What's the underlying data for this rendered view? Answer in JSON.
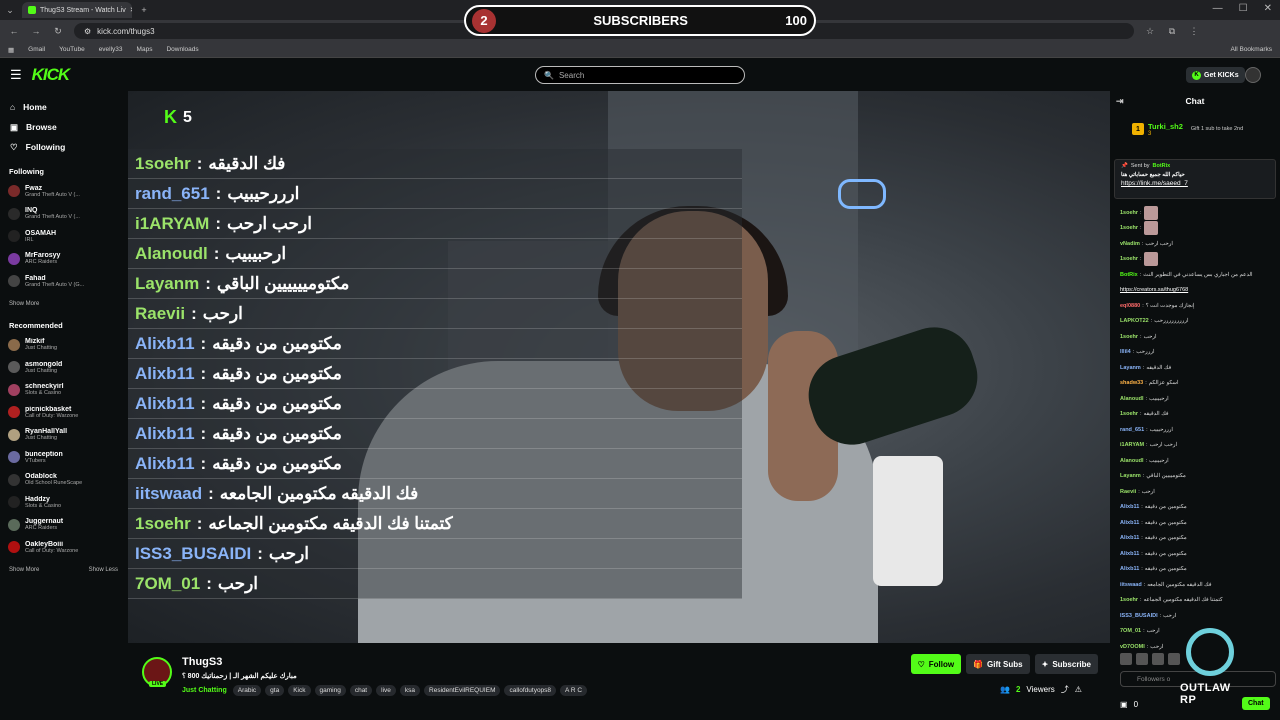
{
  "browser": {
    "tab_title": "ThugS3 Stream - Watch Liv",
    "url": "kick.com/thugs3",
    "bookmarks": [
      "Gmail",
      "YouTube",
      "evelly33",
      "Maps",
      "Downloads"
    ],
    "all_bookmarks": "All Bookmarks"
  },
  "sub_goal": {
    "current": "2",
    "label": "SUBSCRIBERS",
    "target": "100",
    "progress": 0.02
  },
  "header": {
    "logo": "KICK",
    "search_placeholder": "Search",
    "get_kicks": "Get KICKs"
  },
  "sidebar": {
    "nav": [
      {
        "label": "Home"
      },
      {
        "label": "Browse"
      },
      {
        "label": "Following"
      }
    ],
    "following_title": "Following",
    "following": [
      {
        "name": "Fwaz",
        "game": "Grand Theft Auto V (...",
        "viewers": "9.9K",
        "color": "#7a2a2a"
      },
      {
        "name": "INQ",
        "game": "Grand Theft Auto V (...",
        "viewers": "8.3K",
        "color": "#2a2a2a"
      },
      {
        "name": "OSAMAH",
        "game": "IRL",
        "viewers": "4.8K",
        "color": "#222"
      },
      {
        "name": "MrFarosyy",
        "game": "ARC Raiders",
        "viewers": "820",
        "color": "#7a3aa0"
      },
      {
        "name": "Fahad",
        "game": "Grand Theft Auto V (G...",
        "viewers": "791",
        "color": "#444"
      }
    ],
    "show_more": "Show More",
    "recommended_title": "Recommended",
    "recommended": [
      {
        "name": "Mizkif",
        "game": "Just Chatting",
        "viewers": "6.6K",
        "color": "#8a6a4a"
      },
      {
        "name": "asmongold",
        "game": "Just Chatting",
        "viewers": "10.8K",
        "color": "#5a5a5a"
      },
      {
        "name": "schneckyirl",
        "game": "Slots & Casino",
        "viewers": "1.8K",
        "color": "#a04060"
      },
      {
        "name": "picnickbasket",
        "game": "Call of Duty: Warzone",
        "viewers": "395",
        "color": "#b02020"
      },
      {
        "name": "RyanHallYall",
        "game": "Just Chatting",
        "viewers": "80",
        "color": "#b0a080"
      },
      {
        "name": "bunception",
        "game": "VTubers",
        "viewers": "55",
        "color": "#6a6aa0"
      },
      {
        "name": "Odablock",
        "game": "Old School RuneScape",
        "viewers": "9.2K",
        "color": "#333"
      },
      {
        "name": "Haddzy",
        "game": "Slots & Casino",
        "viewers": "1.8K",
        "color": "#222"
      },
      {
        "name": "Juggernaut",
        "game": "ARC Raiders",
        "viewers": "218",
        "color": "#5a6a5a"
      },
      {
        "name": "OakleyBoiii",
        "game": "Call of Duty: Warzone",
        "viewers": "152",
        "color": "#b01010"
      }
    ],
    "show_more_2": "Show More",
    "show_less": "Show Less"
  },
  "video": {
    "k_counter": "5",
    "overlay_chat": [
      {
        "user": "1soehr",
        "msg": "فك الدقيقه",
        "color": "#9be36a"
      },
      {
        "user": "rand_651",
        "msg": "ارررحيبيب",
        "color": "#8ab4f8"
      },
      {
        "user": "i1ARYAM",
        "msg": "ارحب ارحب",
        "color": "#9be36a"
      },
      {
        "user": "Alanoudl",
        "msg": "ارحبيبيب",
        "color": "#9be36a"
      },
      {
        "user": "Layanm",
        "msg": "مكتوميييييين الباقي",
        "color": "#9be36a"
      },
      {
        "user": "Raevii",
        "msg": "ارحب",
        "color": "#9be36a"
      },
      {
        "user": "Alixb11",
        "msg": "مكتومين من دقيقه",
        "color": "#8ab4f8"
      },
      {
        "user": "Alixb11",
        "msg": "مكتومين من دقيقه",
        "color": "#8ab4f8"
      },
      {
        "user": "Alixb11",
        "msg": "مكتومين من دقيقه",
        "color": "#8ab4f8"
      },
      {
        "user": "Alixb11",
        "msg": "مكتومين من دقيقه",
        "color": "#8ab4f8"
      },
      {
        "user": "Alixb11",
        "msg": "مكتومين من دقيقه",
        "color": "#8ab4f8"
      },
      {
        "user": "iitswaad",
        "msg": "فك الدقيقه مكتومين الجامعه",
        "color": "#8ab4f8"
      },
      {
        "user": "1soehr",
        "msg": "كتمتنا فك الدقيقه مكتومين الجماعه",
        "color": "#9be36a"
      },
      {
        "user": "ISS3_BUSAIDI",
        "msg": "ارحب",
        "color": "#8ab4f8"
      },
      {
        "user": "7OM_01",
        "msg": "ارحب",
        "color": "#9be36a"
      }
    ]
  },
  "chat": {
    "title": "Chat",
    "gift_user": "Turki_sh2",
    "gift_count": "3",
    "gift_text": "Gift 1 sub to take 2nd",
    "pinned": {
      "sent_by_label": "Sent by",
      "bot": "BotRix",
      "message": "حياكم الله جميع حساباتي هنا",
      "link": "https://link.me/saeed_7"
    },
    "messages": [
      {
        "user": "1soehr",
        "text": "",
        "color": "#9be36a",
        "emote": true
      },
      {
        "user": "1soehr",
        "text": "",
        "color": "#9be36a",
        "emote": true
      },
      {
        "user": "vNadim",
        "text": "ارحب ارحب",
        "color": "#9be36a"
      },
      {
        "user": "1soehr",
        "text": "",
        "color": "#9be36a",
        "emote": true
      },
      {
        "user": "BotRix",
        "text": "الدعم من اجباري بس يساعدني في التطوير النث",
        "color": "#53fc18"
      },
      {
        "user": "",
        "text": "https://creators.sa/thug6768",
        "color": "#fff"
      },
      {
        "user": "eql0880",
        "text": "إنجازك موجدت انت ؟",
        "color": "#ff6b6b"
      },
      {
        "user": "LAPKOT22",
        "text": "ارررررررررحب",
        "color": "#9be36a"
      },
      {
        "user": "1soehr",
        "text": "ارحب",
        "color": "#9be36a"
      },
      {
        "user": "lllil4",
        "text": "ارررحب",
        "color": "#8ab4f8"
      },
      {
        "user": "Layanm",
        "text": "فك الدقيقه",
        "color": "#8ab4f8"
      },
      {
        "user": "shadw33",
        "text": "اسكو عزالكم",
        "color": "#ffb347"
      },
      {
        "user": "Alanoudl",
        "text": "ارحبيبيب",
        "color": "#9be36a"
      },
      {
        "user": "1soehr",
        "text": "فك الدقيقه",
        "color": "#9be36a"
      },
      {
        "user": "rand_651",
        "text": "ارررحيبيب",
        "color": "#8ab4f8"
      },
      {
        "user": "i1ARYAM",
        "text": "ارحب ارحب",
        "color": "#9be36a"
      },
      {
        "user": "Alanoudl",
        "text": "ارحبيبيب",
        "color": "#9be36a"
      },
      {
        "user": "Layanm",
        "text": "مكتوميييين الباقي",
        "color": "#9be36a"
      },
      {
        "user": "Raevii",
        "text": "ارحب",
        "color": "#9be36a"
      },
      {
        "user": "Alixb11",
        "text": "مكتومين من دقيقه",
        "color": "#8ab4f8"
      },
      {
        "user": "Alixb11",
        "text": "مكتومين من دقيقه",
        "color": "#8ab4f8"
      },
      {
        "user": "Alixb11",
        "text": "مكتومين من دقيقه",
        "color": "#8ab4f8"
      },
      {
        "user": "Alixb11",
        "text": "مكتومين من دقيقه",
        "color": "#8ab4f8"
      },
      {
        "user": "Alixb11",
        "text": "مكتومين من دقيقه",
        "color": "#8ab4f8"
      },
      {
        "user": "iitswaad",
        "text": "فك الدقيقه مكتومين الجامعه",
        "color": "#8ab4f8"
      },
      {
        "user": "1soehr",
        "text": "كتمتنا فك الدقيقه مكتومين الجماعه",
        "color": "#9be36a"
      },
      {
        "user": "ISS3_BUSAIDI",
        "text": "ارحب",
        "color": "#8ab4f8"
      },
      {
        "user": "7OM_01",
        "text": "ارحب",
        "color": "#9be36a"
      },
      {
        "user": "vD7OOMI",
        "text": "ارحب",
        "color": "#9be36a"
      }
    ],
    "input_placeholder": "Followers o",
    "kicks_count": "0",
    "chat_button": "Chat"
  },
  "stream": {
    "name": "ThugS3",
    "live_label": "LIVE",
    "title": "مبارك عليكم الشهر الـ | زحمناتيك 800 ؟",
    "category": "Just Chatting",
    "tags": [
      "Arabic",
      "gta",
      "Kick",
      "gaming",
      "chat",
      "live",
      "ksa",
      "ResidentEvilREQUIEM",
      "callofdutyops8",
      "A R C"
    ],
    "follow": "Follow",
    "gift_subs": "Gift Subs",
    "subscribe": "Subscribe",
    "viewers": "2",
    "viewers_label": "Viewers"
  },
  "watermark": "OUTLAW RP"
}
